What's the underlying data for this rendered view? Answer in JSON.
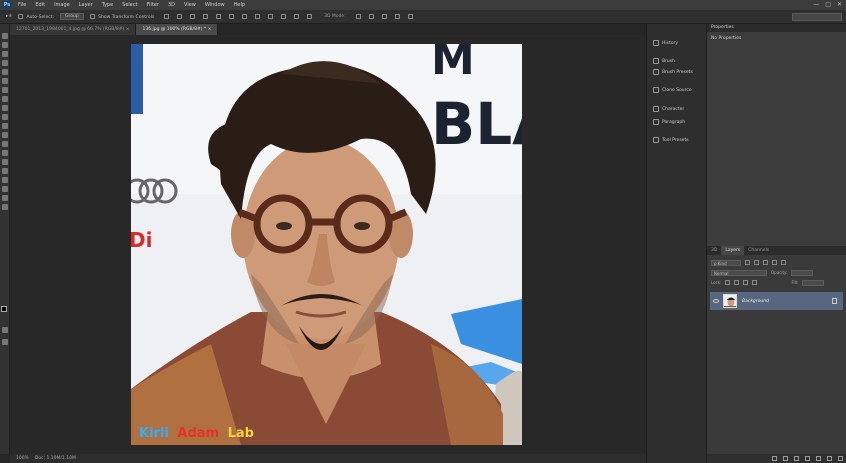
{
  "menu": {
    "items": [
      "File",
      "Edit",
      "Image",
      "Layer",
      "Type",
      "Select",
      "Filter",
      "3D",
      "View",
      "Window",
      "Help"
    ],
    "logo": "Ps"
  },
  "window_controls": {
    "minimize": "—",
    "maximize": "□",
    "close": "✕"
  },
  "options": {
    "auto_select_label": "Auto-Select:",
    "auto_select_value": "Group",
    "show_transform_label": "Show Transform Controls",
    "mode_3d_label": "3D Mode:"
  },
  "tabs": [
    {
      "label": "12701_2013_1984001_4.jpg @ 66.7% (RGB/8#) ×"
    },
    {
      "label": "136.jpg @ 100% (RGB/8#) * ×"
    }
  ],
  "status": {
    "zoom": "100%",
    "doc": "Doc: 1.10M/1.10M"
  },
  "panel_buttons": [
    {
      "label": "History"
    },
    {
      "label": "Brush"
    },
    {
      "label": "Brush Presets"
    },
    {
      "label": "Clone Source"
    },
    {
      "label": "Character"
    },
    {
      "label": "Paragraph"
    },
    {
      "label": "Tool Presets"
    }
  ],
  "properties": {
    "title": "Properties",
    "empty_text": "No Properties"
  },
  "layers": {
    "tabs": [
      "3D",
      "Layers",
      "Channels"
    ],
    "active_tab": "Layers",
    "kind_label": "ρ Kind",
    "blend_mode": "Normal",
    "opacity_label": "Opacity:",
    "lock_label": "Lock:",
    "fill_label": "Fill:",
    "layer_name": "Background"
  },
  "photo": {
    "watermark": [
      {
        "text": "Kirli",
        "color": "#2fb0ff"
      },
      {
        "text": "Adam",
        "color": "#e8302a"
      },
      {
        "text": "Lab",
        "color": "#f2d53c"
      }
    ],
    "bg_letters": [
      "M",
      "BLA"
    ],
    "bg_red_text": "Di"
  }
}
